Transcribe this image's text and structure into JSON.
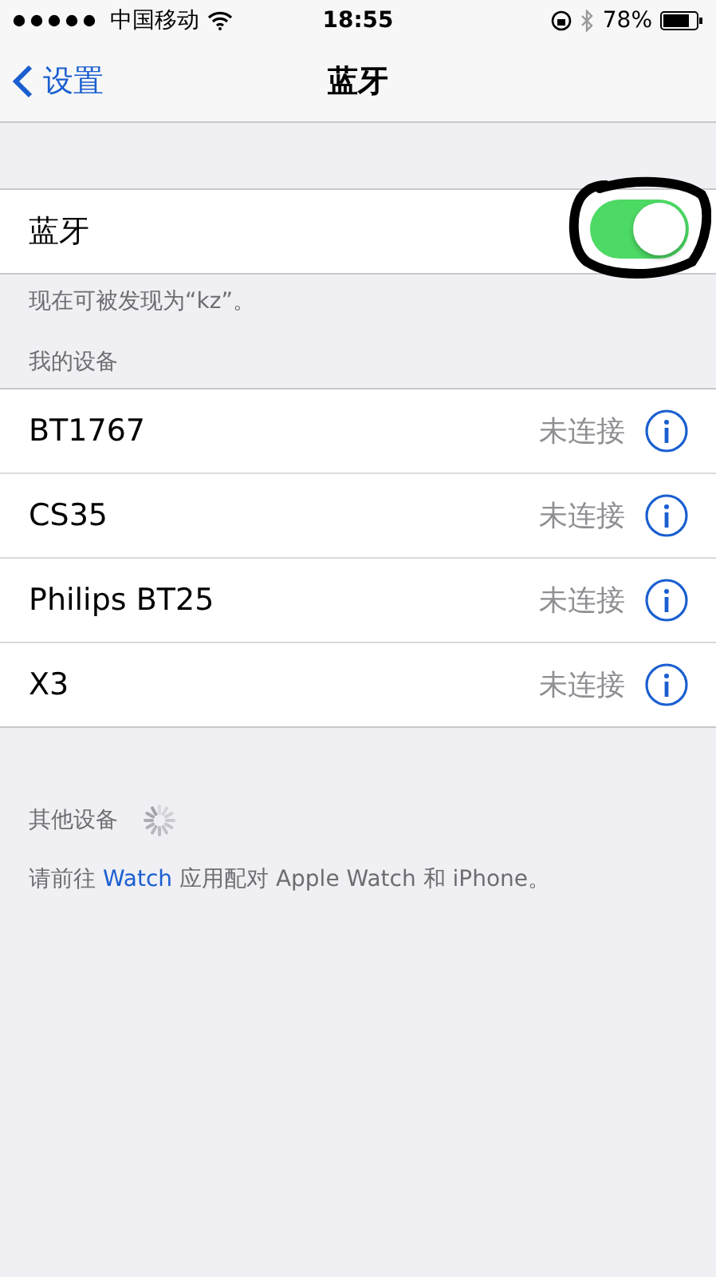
{
  "status_bar": {
    "carrier": "中国移动",
    "time": "18:55",
    "battery": "78%"
  },
  "nav": {
    "back": "设置",
    "title": "蓝牙"
  },
  "bluetooth": {
    "label": "蓝牙",
    "on": true
  },
  "discoverable_note": "现在可被发现为“kz”。",
  "my_devices": {
    "header": "我的设备",
    "devices": [
      {
        "name": "BT1767",
        "status": "未连接"
      },
      {
        "name": "CS35",
        "status": "未连接"
      },
      {
        "name": "Philips BT25",
        "status": "未连接"
      },
      {
        "name": "X3",
        "status": "未连接"
      }
    ]
  },
  "other_devices": {
    "header": "其他设备",
    "searching": true
  },
  "watch_note": {
    "before": "请前往",
    "link": "Watch",
    "after": "应用配对 Apple Watch 和 iPhone。"
  }
}
